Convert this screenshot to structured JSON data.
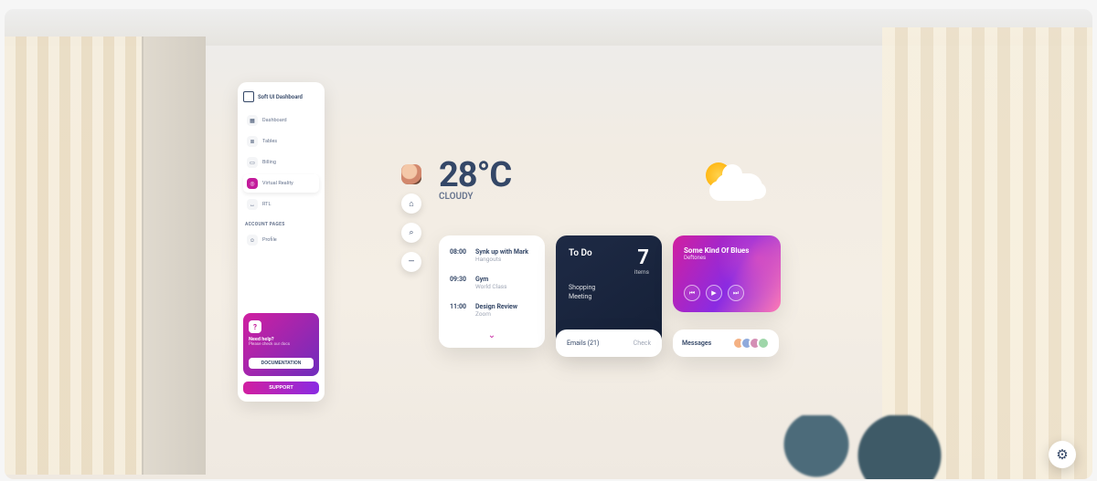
{
  "app": {
    "title": "Soft UI Dashboard"
  },
  "sidebar": {
    "items": [
      {
        "icon": "grid-icon",
        "label": "Dashboard"
      },
      {
        "icon": "table-icon",
        "label": "Tables"
      },
      {
        "icon": "card-icon",
        "label": "Billing"
      },
      {
        "icon": "vr-icon",
        "label": "Virtual Reality"
      },
      {
        "icon": "rtl-icon",
        "label": "RTL"
      }
    ],
    "active_index": 3,
    "section_label": "ACCOUNT PAGES",
    "account_items": [
      {
        "icon": "user-icon",
        "label": "Profile"
      }
    ]
  },
  "help": {
    "title": "Need help?",
    "subtitle": "Please check our docs",
    "doc_button": "DOCUMENTATION",
    "support_button": "SUPPORT"
  },
  "action_buttons": {
    "home": "⌂",
    "search": "⌕",
    "minimize": "—"
  },
  "weather": {
    "temperature": "28°C",
    "condition": "CLOUDY",
    "icon": "sun-cloud-icon"
  },
  "schedule": [
    {
      "time": "08:00",
      "title": "Synk up with Mark",
      "subtitle": "Hangouts"
    },
    {
      "time": "09:30",
      "title": "Gym",
      "subtitle": "World Class"
    },
    {
      "time": "11:00",
      "title": "Design Review",
      "subtitle": "Zoom"
    }
  ],
  "todo": {
    "heading": "To Do",
    "count": "7",
    "count_label": "items",
    "items": [
      "Shopping",
      "Meeting"
    ]
  },
  "music": {
    "title": "Some Kind Of Blues",
    "artist": "Deftones"
  },
  "emails": {
    "label": "Emails (21)",
    "action": "Check"
  },
  "messages": {
    "label": "Messages"
  },
  "colors": {
    "accent": "#c31b9b",
    "dark_card": "#1e2a45",
    "text": "#344767",
    "muted": "#67748e"
  }
}
